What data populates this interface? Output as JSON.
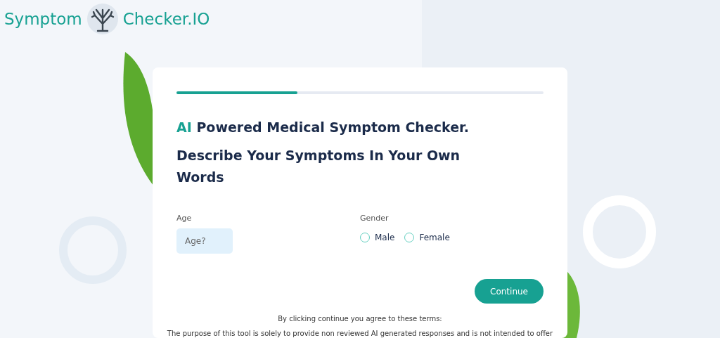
{
  "logo": {
    "text_left": "Symptom",
    "text_right": "Checker.IO"
  },
  "progress": {
    "level": 0.33
  },
  "heading": {
    "accent": "AI",
    "rest": "Powered Medical Symptom Checker.",
    "subtitle": "Describe Your Symptoms In Your Own Words"
  },
  "age": {
    "label": "Age",
    "placeholder": "Age?"
  },
  "gender": {
    "label": "Gender",
    "options": [
      {
        "label": "Male",
        "selected": false
      },
      {
        "label": "Female",
        "selected": false
      }
    ]
  },
  "continue_button": "Continue",
  "terms": {
    "heading": "By clicking continue you agree to these terms:",
    "text": "The purpose of this tool is solely to provide non reviewed AI generated responses and is not intended to offer"
  }
}
